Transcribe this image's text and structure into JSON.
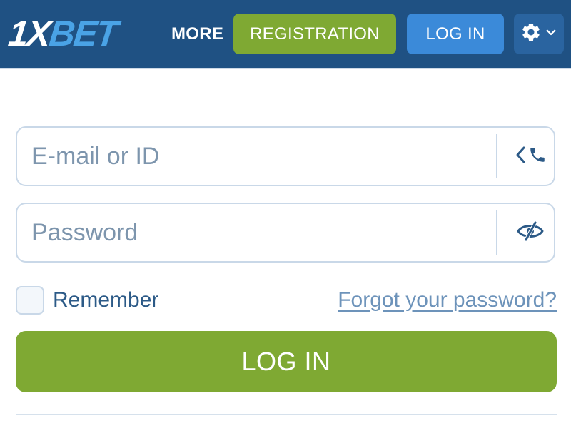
{
  "header": {
    "logo": {
      "prefix": "1X",
      "suffix": "BET"
    },
    "more_label": "MORE",
    "registration_label": "REGISTRATION",
    "login_label": "LOG IN",
    "settings_icon": "gear-icon",
    "settings_chevron_icon": "chevron-down-icon"
  },
  "form": {
    "email": {
      "placeholder": "E-mail or ID",
      "value": "",
      "suffix_icons": [
        "chevron-left-icon",
        "phone-icon"
      ]
    },
    "password": {
      "placeholder": "Password",
      "value": "",
      "suffix_icon": "eye-slash-icon"
    },
    "remember": {
      "label": "Remember",
      "checked": false
    },
    "forgot_password_label": "Forgot your password?",
    "login_button_label": "LOG IN"
  },
  "colors": {
    "header_bg": "#1f5183",
    "accent_green": "#7fa933",
    "accent_blue": "#3b8ad9",
    "logo_blue": "#4aa3e6",
    "field_border": "#c9d8e8",
    "placeholder_text": "#7d95ad",
    "link_text": "#6d93ba"
  }
}
